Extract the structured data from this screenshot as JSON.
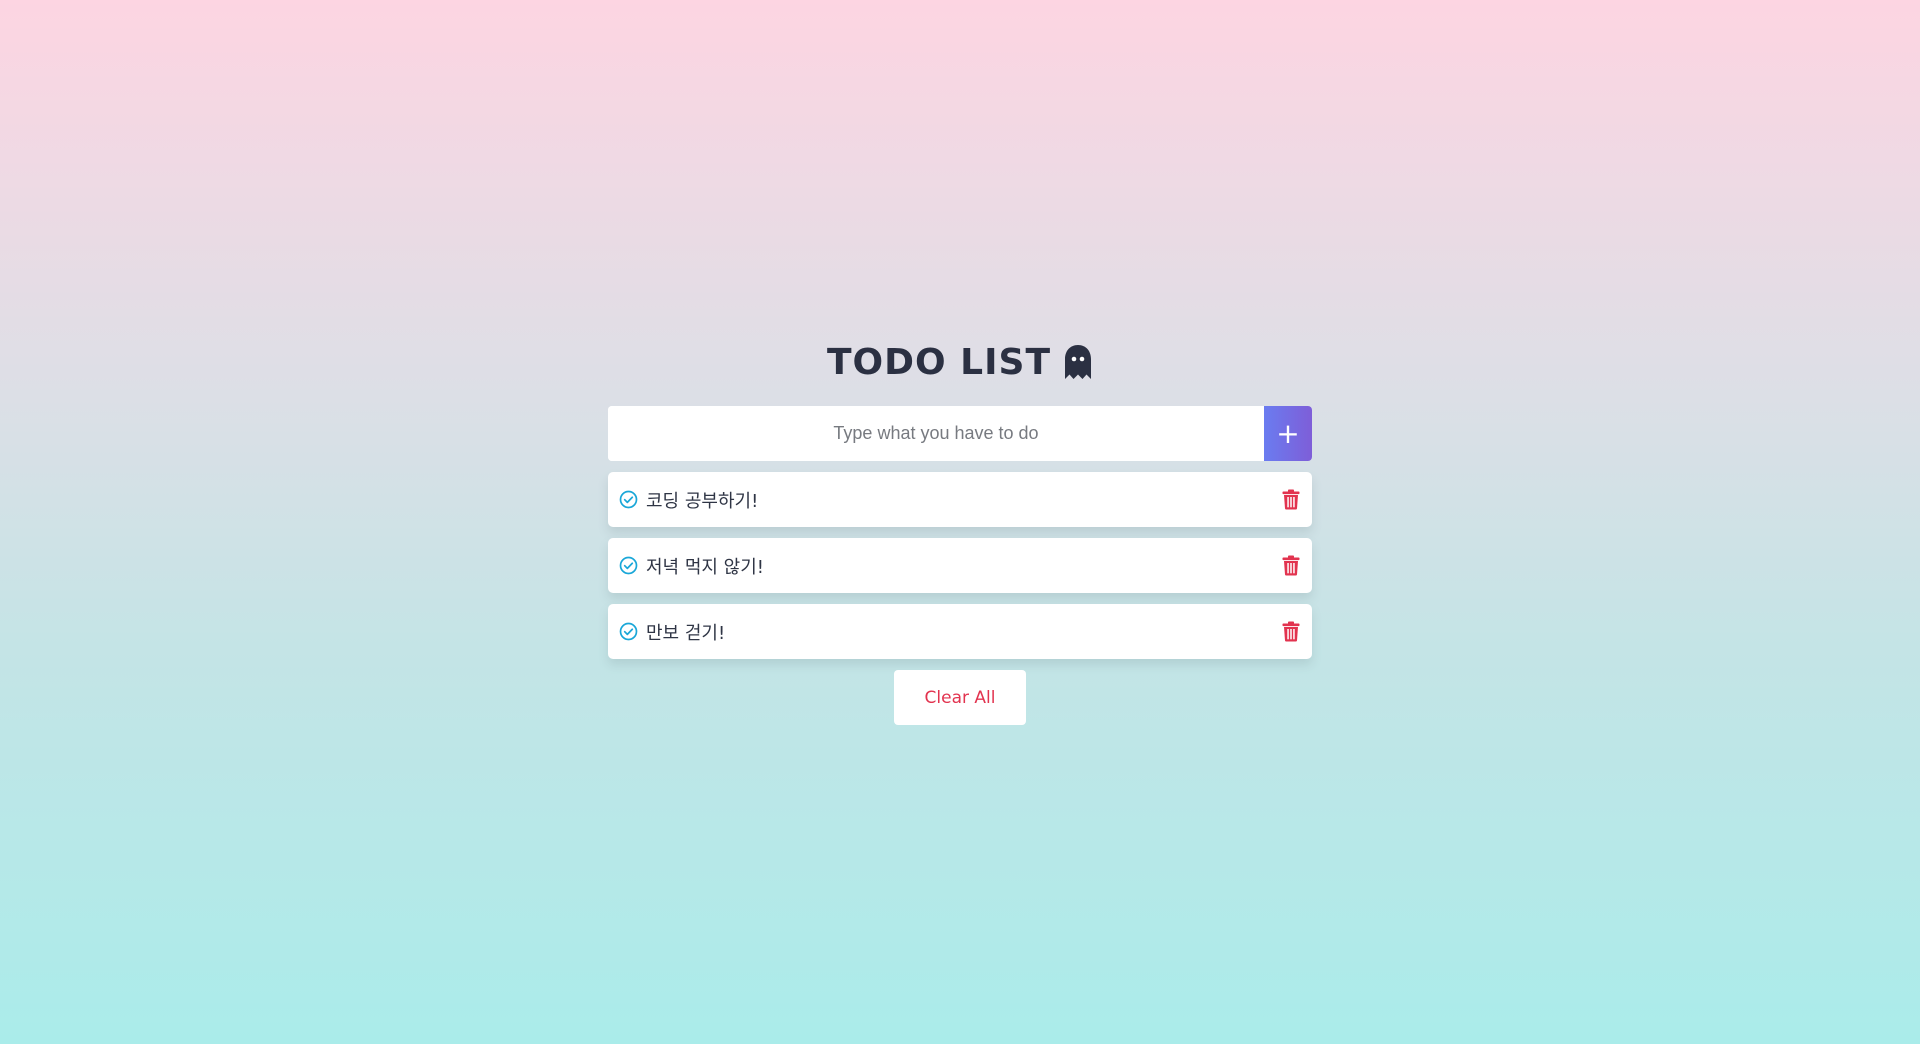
{
  "header": {
    "title": "TODO LIST",
    "icon": "ghost-icon"
  },
  "input": {
    "value": "",
    "placeholder": "Type what you have to do",
    "add_label": "+"
  },
  "todos": [
    {
      "text": "코딩 공부하기!",
      "check_icon": "check-circle-icon",
      "delete_icon": "trash-icon"
    },
    {
      "text": "저녁 먹지 않기!",
      "check_icon": "check-circle-icon",
      "delete_icon": "trash-icon"
    },
    {
      "text": "만보 걷기!",
      "check_icon": "check-circle-icon",
      "delete_icon": "trash-icon"
    }
  ],
  "footer": {
    "clear_label": "Clear All"
  },
  "colors": {
    "accent_start": "#6a7cf0",
    "accent_end": "#7e5ed8",
    "check": "#1aa7d8",
    "danger": "#e2334f",
    "bg_top": "#fdd5e2",
    "bg_bottom": "#aaecea"
  }
}
